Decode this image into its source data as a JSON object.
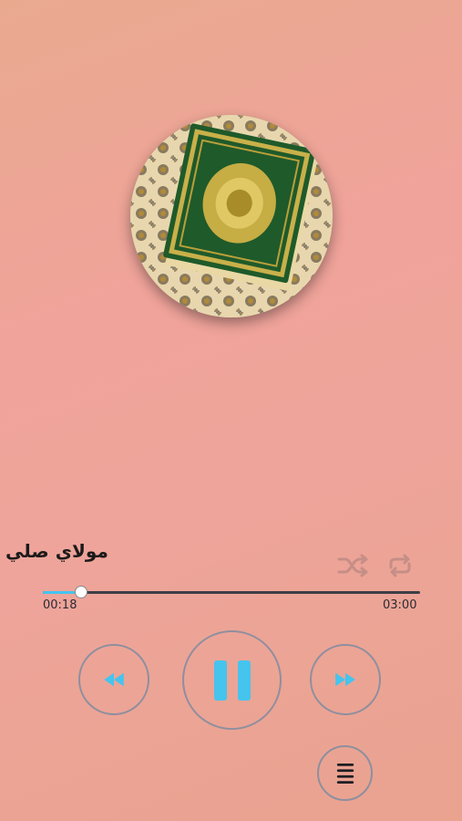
{
  "player": {
    "track_title": "مولاي صلي",
    "elapsed": "00:18",
    "duration": "03:00",
    "progress": 0.1
  },
  "icons": {
    "shuffle": "shuffle-icon",
    "repeat": "repeat-icon",
    "previous": "rewind-icon",
    "play_pause": "pause-icon",
    "next": "fast-forward-icon",
    "menu": "playlist-menu-icon"
  },
  "colors": {
    "accent": "#45c4ee",
    "track": "#3d3f46",
    "button_outline": "#8e8f9e"
  }
}
